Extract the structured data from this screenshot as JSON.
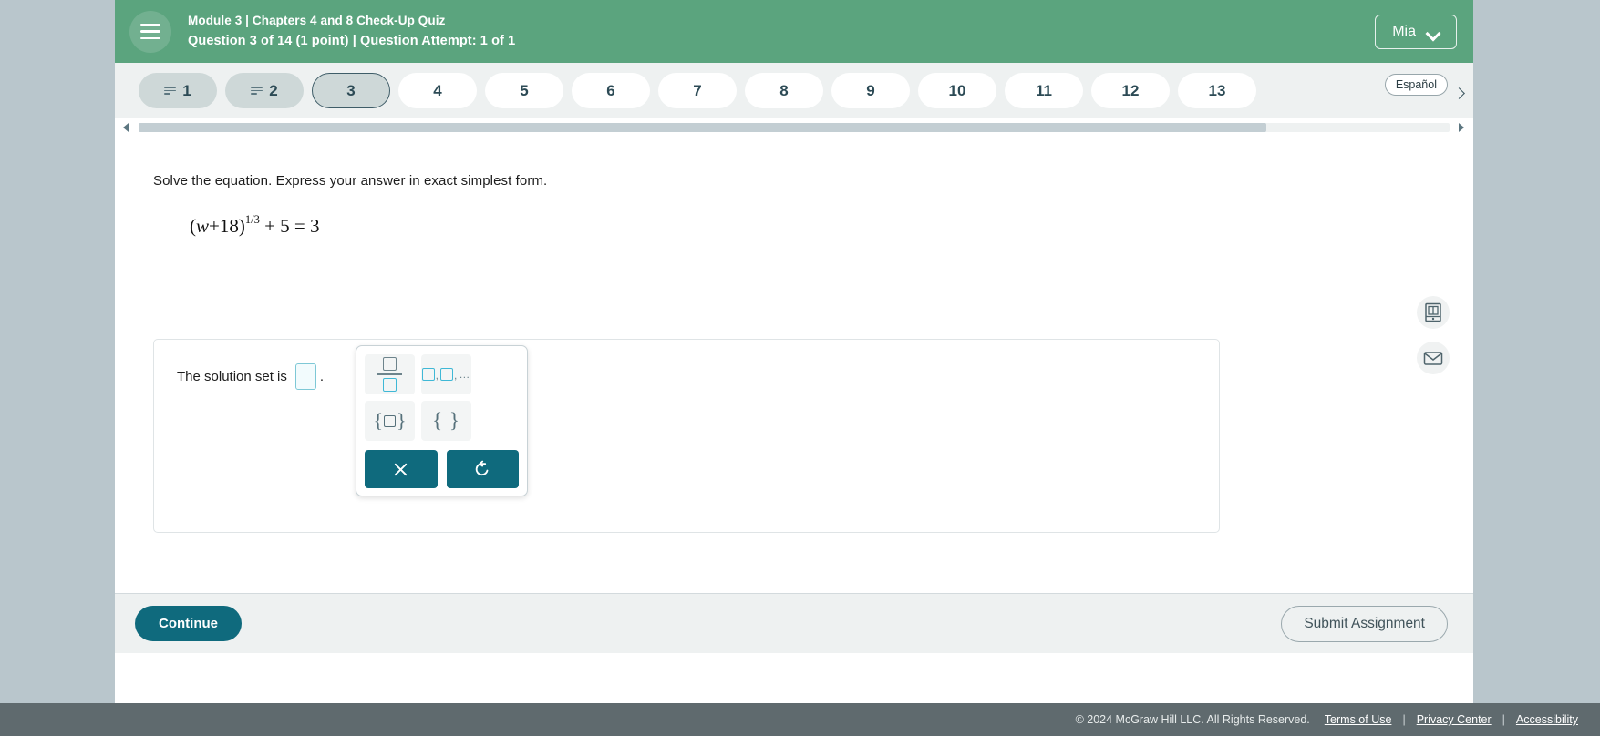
{
  "header": {
    "menu_icon": "hamburger-icon",
    "course_line": "Module 3 | Chapters 4 and 8 Check-Up Quiz",
    "question_line": "Question 3 of 14 (1 point)  |  Question Attempt: 1 of 1",
    "user_name": "Mia",
    "user_caret_icon": "chevron-down-icon"
  },
  "question_nav": {
    "espanol_label": "Español",
    "next_icon": "chevron-right-icon",
    "pills": [
      {
        "label": "1",
        "state": "answered"
      },
      {
        "label": "2",
        "state": "answered"
      },
      {
        "label": "3",
        "state": "current"
      },
      {
        "label": "4",
        "state": "unanswered"
      },
      {
        "label": "5",
        "state": "unanswered"
      },
      {
        "label": "6",
        "state": "unanswered"
      },
      {
        "label": "7",
        "state": "unanswered"
      },
      {
        "label": "8",
        "state": "unanswered"
      },
      {
        "label": "9",
        "state": "unanswered"
      },
      {
        "label": "10",
        "state": "unanswered"
      },
      {
        "label": "11",
        "state": "unanswered"
      },
      {
        "label": "12",
        "state": "unanswered"
      },
      {
        "label": "13",
        "state": "unanswered"
      }
    ]
  },
  "scrollbar": {
    "left_arrow_icon": "triangle-left-icon",
    "right_arrow_icon": "triangle-right-icon"
  },
  "question": {
    "prompt": "Solve the equation. Express your answer in exact simplest form.",
    "equation": {
      "open_paren": "(",
      "variable": "w",
      "plus": "+",
      "constant": "18",
      "close_paren": ")",
      "exponent": "1/3",
      "tail": "+ 5 = 3",
      "plain": "(w + 18)^(1/3) + 5 = 3"
    },
    "answer_label_prefix": "The solution set is",
    "answer_value": "",
    "answer_label_suffix": "."
  },
  "math_palette": {
    "keys": [
      {
        "name": "fraction-key",
        "icon": "fraction-icon"
      },
      {
        "name": "comma-list-key",
        "icon": "comma-list-icon"
      },
      {
        "name": "set-braces-key",
        "icon": "set-braces-icon"
      },
      {
        "name": "empty-set-key",
        "icon": "empty-set-icon"
      }
    ],
    "actions": [
      {
        "name": "clear-button",
        "icon": "close-x-icon"
      },
      {
        "name": "undo-button",
        "icon": "undo-arrow-icon"
      }
    ]
  },
  "utility_rail": [
    {
      "name": "ebook-button",
      "icon": "book-icon"
    },
    {
      "name": "message-button",
      "icon": "envelope-icon"
    }
  ],
  "actions": {
    "continue_label": "Continue",
    "submit_label": "Submit Assignment"
  },
  "footer": {
    "copyright": "© 2024 McGraw Hill LLC. All Rights Reserved.",
    "links": [
      "Terms of Use",
      "Privacy Center",
      "Accessibility"
    ],
    "separator": "|"
  },
  "colors": {
    "header_green": "#5ba47e",
    "accent_teal": "#0f6a7d",
    "nav_strip": "#eef1f1",
    "footer_gray": "#5f6a6e",
    "input_cyan": "#7ec8d6"
  }
}
